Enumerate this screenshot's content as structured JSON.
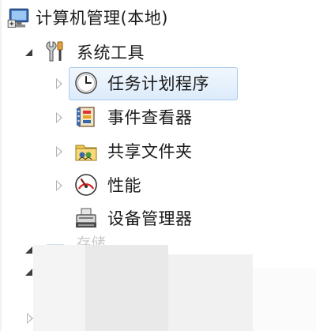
{
  "tree": {
    "root_label": "计算机管理(本地)",
    "system_tools_label": "系统工具",
    "items": [
      {
        "label": "任务计划程序",
        "icon": "clock-icon"
      },
      {
        "label": "事件查看器",
        "icon": "event-viewer-icon"
      },
      {
        "label": "共享文件夹",
        "icon": "shared-folder-icon"
      },
      {
        "label": "性能",
        "icon": "performance-icon"
      },
      {
        "label": "设备管理器",
        "icon": "device-manager-icon"
      }
    ],
    "storage_label": "存储"
  },
  "colors": {
    "selection_bg": "#dcebfb",
    "selection_border": "#a9cbef"
  }
}
